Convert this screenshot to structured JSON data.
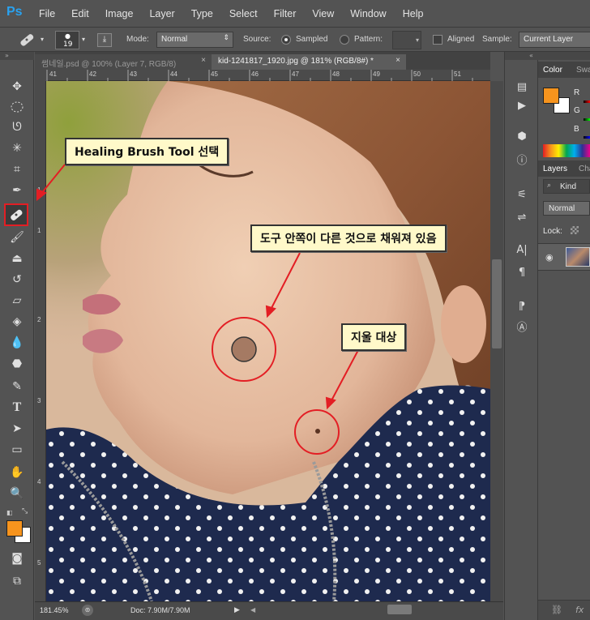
{
  "menubar": {
    "logo": "Ps",
    "items": [
      "File",
      "Edit",
      "Image",
      "Layer",
      "Type",
      "Select",
      "Filter",
      "View",
      "Window",
      "Help"
    ]
  },
  "options": {
    "brush_size": "19",
    "mode_label": "Mode:",
    "mode_value": "Normal",
    "source_label": "Source:",
    "sampled_label": "Sampled",
    "pattern_label": "Pattern:",
    "aligned_label": "Aligned",
    "sample_label": "Sample:",
    "sample_value": "Current Layer"
  },
  "tabs": [
    {
      "label": "썸네일.psd @ 100% (Layer 7, RGB/8)",
      "close": "×",
      "active": false
    },
    {
      "label": "kid-1241817_1920.jpg @ 181% (RGB/8#) *",
      "close": "×",
      "active": true
    }
  ],
  "ruler": {
    "h_ticks": [
      "41",
      "42",
      "43",
      "44",
      "45",
      "46",
      "47",
      "48",
      "49",
      "50",
      "51"
    ],
    "v_ticks": [
      "1",
      "1",
      "2",
      "3",
      "4",
      "5"
    ]
  },
  "status": {
    "zoom": "181.45%",
    "doc": "Doc: 7.90M/7.90M"
  },
  "callouts": {
    "tool": "Healing Brush Tool 선택",
    "inside": "도구 안쪽이 다른 것으로 채워져 있음",
    "target": "지울 대상"
  },
  "right_panel": {
    "color_tab": "Color",
    "swatches_tab": "Swa",
    "channels": [
      "R",
      "G",
      "B"
    ],
    "layers_tab": "Layers",
    "channels_tab": "Cha",
    "kind_label": "Kind",
    "blend_mode": "Normal",
    "lock_label": "Lock:",
    "fx_label": "fx"
  },
  "colors": {
    "foreground": "#f7941d",
    "background": "#ffffff",
    "highlight_red": "#e31e24",
    "callout_bg": "#fff9c9"
  }
}
